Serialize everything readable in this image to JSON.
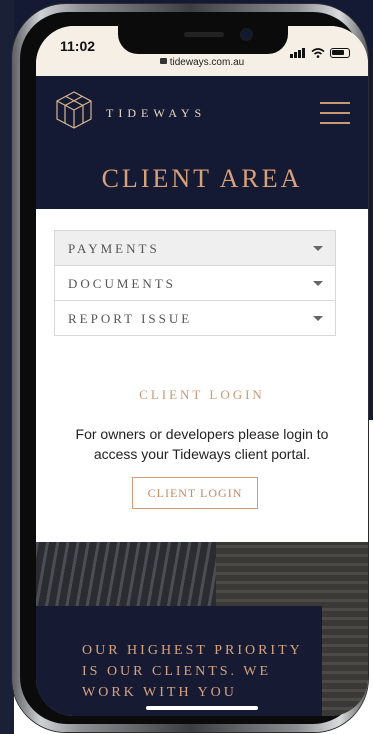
{
  "status_bar": {
    "time": "11:02",
    "url": "tideways.com.au"
  },
  "header": {
    "brand": "TIDEWAYS",
    "title": "CLIENT AREA"
  },
  "accordion": [
    {
      "label": "Payments",
      "active": true
    },
    {
      "label": "Documents",
      "active": false
    },
    {
      "label": "Report issue",
      "active": false
    }
  ],
  "login": {
    "title": "Client Login",
    "text": "For owners or developers please login to access your Tideways client portal.",
    "button": "CLIENT LOGIN"
  },
  "promo": {
    "text": "Our highest priority is our clients. We work with you"
  },
  "colors": {
    "navy": "#141a33",
    "accent": "#c79a73"
  }
}
